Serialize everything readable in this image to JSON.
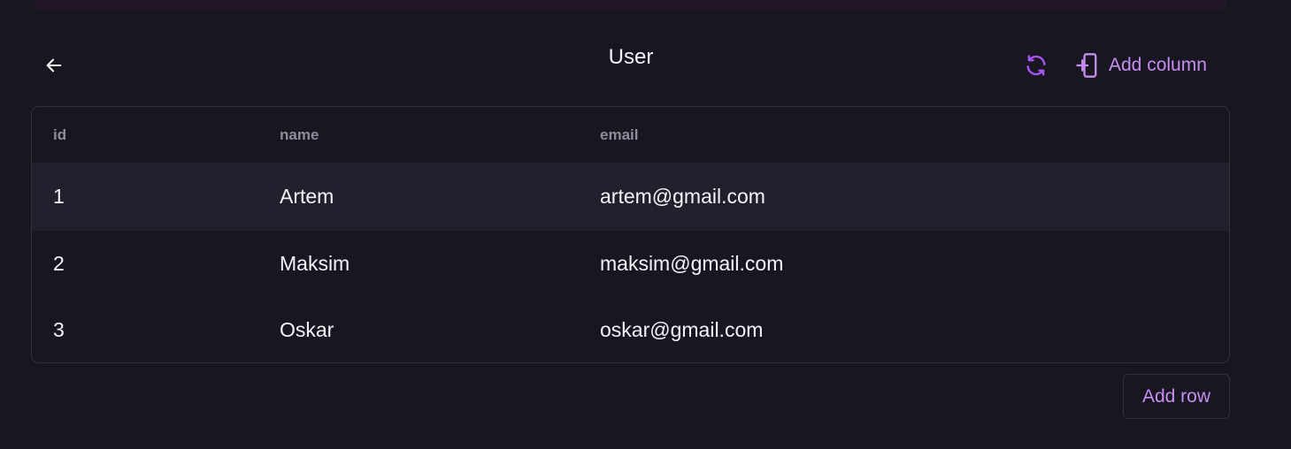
{
  "header": {
    "title": "User",
    "back_icon": "arrow-left-icon",
    "refresh_icon": "refresh-icon",
    "add_column_label": "Add column",
    "add_column_icon": "add-column-icon"
  },
  "table": {
    "columns": [
      "id",
      "name",
      "email"
    ],
    "rows": [
      {
        "id": "1",
        "name": "Artem",
        "email": "artem@gmail.com"
      },
      {
        "id": "2",
        "name": "Maksim",
        "email": "maksim@gmail.com"
      },
      {
        "id": "3",
        "name": "Oskar",
        "email": "oskar@gmail.com"
      }
    ]
  },
  "footer": {
    "add_row_label": "Add row"
  },
  "colors": {
    "background": "#181621",
    "accent": "#c58ef0",
    "accent_icon": "#a855f7",
    "border": "#34313f",
    "highlight_row": "#22202d"
  }
}
